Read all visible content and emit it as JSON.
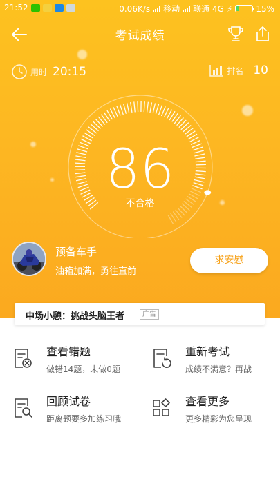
{
  "status_bar": {
    "time": "21:52",
    "speed": "0.06K/s",
    "carrier1": "移动",
    "carrier2": "联通 4G",
    "battery": "15%",
    "battery_level": 0.15
  },
  "nav": {
    "title": "考试成绩"
  },
  "stats": {
    "time_label": "用时",
    "time_value": "20:15",
    "rank_label": "排名",
    "rank_value": "10"
  },
  "score": {
    "value": "86",
    "result": "不合格",
    "max": 100
  },
  "user": {
    "name": "预备车手",
    "motto": "油箱加满，勇往直前",
    "comfort_button": "求安慰"
  },
  "ad": {
    "text": "中场小憩：挑战头脑王者",
    "tag": "广告"
  },
  "actions": [
    {
      "title": "查看错题",
      "subtitle": "做错14题，未做0题",
      "icon": "wrong-answers-icon"
    },
    {
      "title": "重新考试",
      "subtitle": "成绩不满意？再战",
      "icon": "retake-exam-icon"
    },
    {
      "title": "回顾试卷",
      "subtitle": "距离题要多加练习哦",
      "icon": "review-paper-icon"
    },
    {
      "title": "查看更多",
      "subtitle": "更多精彩为您呈现",
      "icon": "more-apps-icon"
    }
  ],
  "colors": {
    "accent": "#FDB722",
    "button_text": "#F7A21A"
  }
}
